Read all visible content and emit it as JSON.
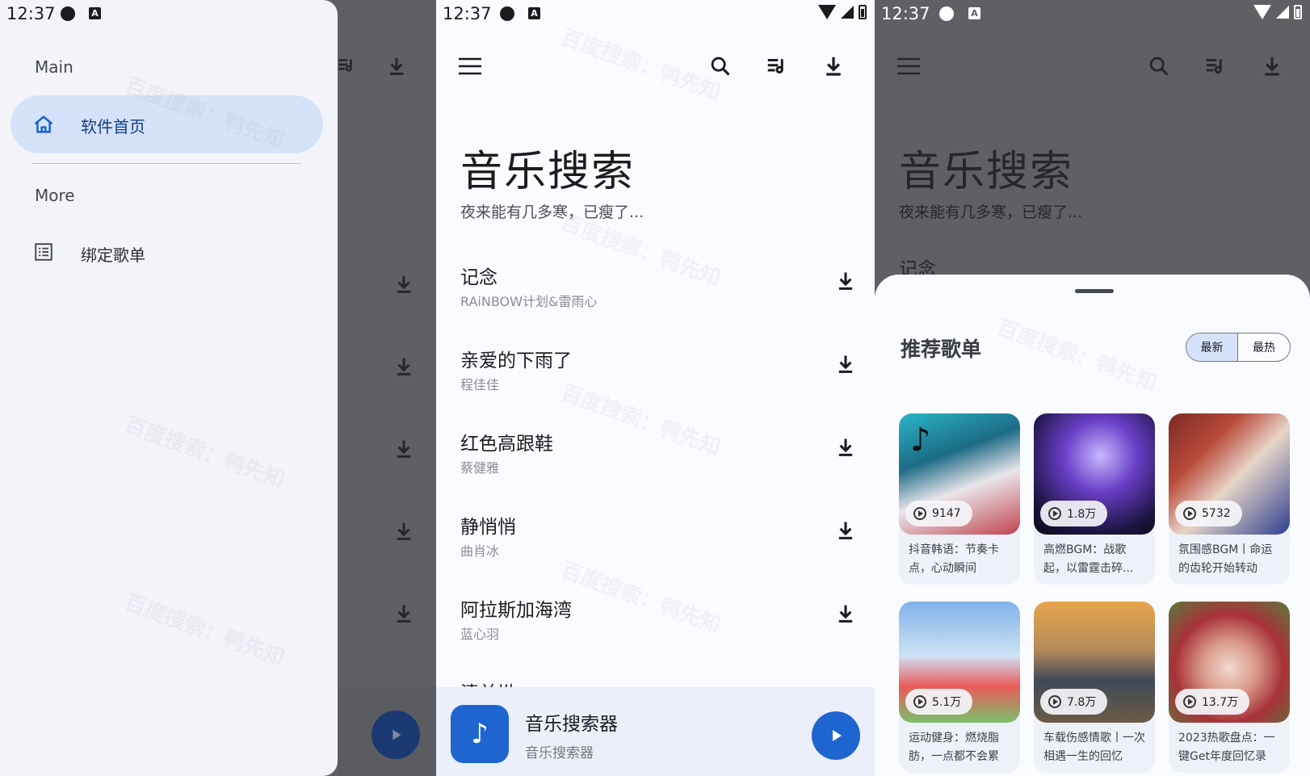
{
  "status": {
    "time": "12:37"
  },
  "drawer": {
    "section_main": "Main",
    "home_label": "软件首页",
    "section_more": "More",
    "bind_playlist_label": "绑定歌单"
  },
  "app": {
    "title": "音乐搜索",
    "subtitle": "夜来能有几多寒，已瘦了..."
  },
  "songs": [
    {
      "title": "记念",
      "artist": "RAiNBOW计划&雷雨心"
    },
    {
      "title": "亲爱的下雨了",
      "artist": "程佳佳"
    },
    {
      "title": "红色高跟鞋",
      "artist": "蔡健雅"
    },
    {
      "title": "静悄悄",
      "artist": "曲肖冰"
    },
    {
      "title": "阿拉斯加海湾",
      "artist": "蓝心羽"
    },
    {
      "title": "清羊坳",
      "artist": ""
    }
  ],
  "player": {
    "title": "音乐搜索器",
    "subtitle": "音乐搜索器"
  },
  "sheet": {
    "title": "推荐歌单",
    "tab_latest": "最新",
    "tab_hot": "最热",
    "playlists": [
      {
        "plays": "9147",
        "name": "抖音韩语：节奏卡点，心动瞬间"
      },
      {
        "plays": "1.8万",
        "name": "高燃BGM：战歌起，以雷霆击碎..."
      },
      {
        "plays": "5732",
        "name": "氛围感BGM丨命运的齿轮开始转动"
      },
      {
        "plays": "5.1万",
        "name": "运动健身：燃烧脂肪，一点都不会累"
      },
      {
        "plays": "7.8万",
        "name": "车载伤感情歌丨一次相遇一生的回忆"
      },
      {
        "plays": "13.7万",
        "name": "2023热歌盘点：一键Get年度回忆录"
      }
    ]
  },
  "watermark": "百度搜索：鸭先知",
  "colors": {
    "accent": "#1f65d0",
    "drawer_active": "#d6e2fa",
    "scrim": "#5f6064"
  }
}
